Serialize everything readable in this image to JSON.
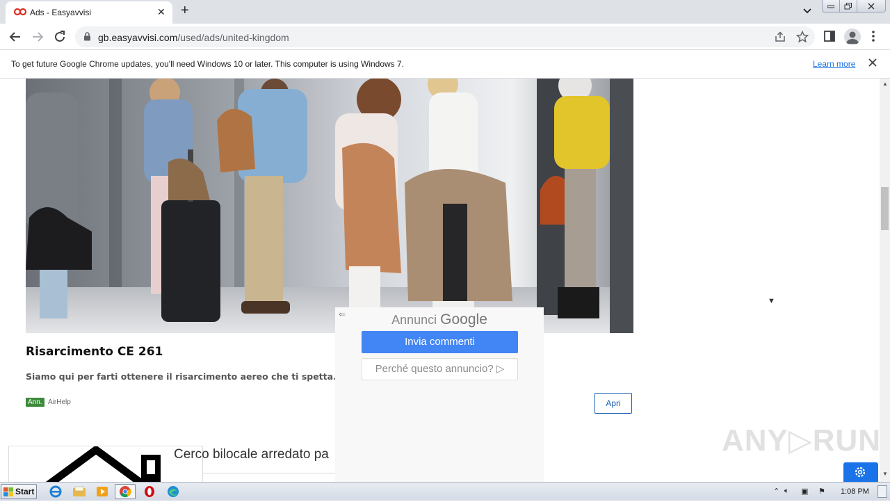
{
  "browser": {
    "tab": {
      "title": "Ads - Easyavvisi",
      "close_glyph": "✕"
    },
    "new_tab_glyph": "+",
    "url_host": "gb.easyavvisi.com",
    "url_path": "/used/ads/united-kingdom"
  },
  "infobar": {
    "message": "To get future Google Chrome updates, you'll need Windows 10 or later. This computer is using Windows 7.",
    "link": "Learn more"
  },
  "ad": {
    "title": "Risarcimento CE 261",
    "description": "Siamo qui per farti ottenere il risarcimento aereo che ti spetta. Controlla",
    "badge": "Ann.",
    "advertiser": "AirHelp",
    "open_label": "Apri"
  },
  "google_overlay": {
    "brand_prefix": "Annunci",
    "brand_name": "Google",
    "feedback_label": "Invia commenti",
    "why_label": "Perché questo annuncio?",
    "why_icon": "▷"
  },
  "listing": {
    "title": "Cerco bilocale arredato pa"
  },
  "watermark": "ANY▷RUN",
  "taskbar": {
    "start_label": "Start",
    "clock": "1:08 PM",
    "apps": [
      "ie-icon",
      "explorer-icon",
      "media-player-icon",
      "chrome-icon",
      "opera-icon",
      "edge-icon"
    ]
  },
  "colors": {
    "chrome_accent": "#1a73e8",
    "ad_badge": "#3b8b3b",
    "google_blue": "#4285f4"
  }
}
